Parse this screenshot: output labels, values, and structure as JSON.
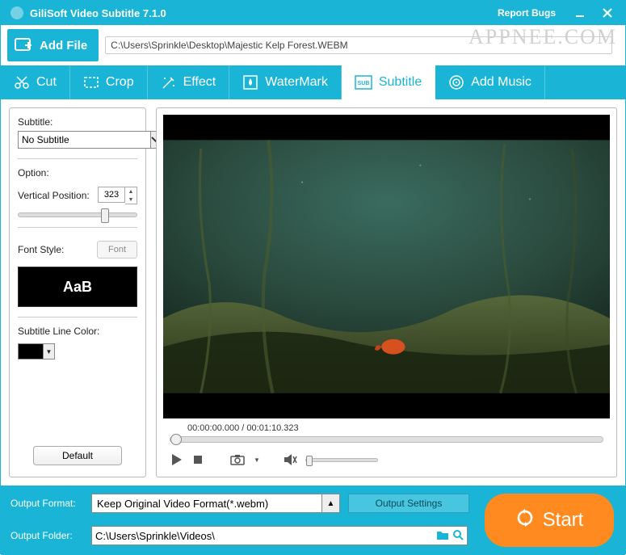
{
  "titlebar": {
    "title": "GiliSoft Video Subtitle 7.1.0",
    "report": "Report Bugs"
  },
  "toolbar": {
    "add_file": "Add File",
    "filepath": "C:\\Users\\Sprinkle\\Desktop\\Majestic Kelp Forest.WEBM",
    "watermark": "APPNEE.COM"
  },
  "tabs": {
    "cut": "Cut",
    "crop": "Crop",
    "effect": "Effect",
    "watermark": "WaterMark",
    "subtitle": "Subtitle",
    "add_music": "Add Music"
  },
  "sidebar": {
    "subtitle_label": "Subtitle:",
    "subtitle_value": "No Subtitle",
    "option_label": "Option:",
    "vpos_label": "Vertical Position:",
    "vpos_value": "323",
    "font_style_label": "Font Style:",
    "font_button": "Font",
    "font_preview": "AaB",
    "line_color_label": "Subtitle Line Color:",
    "line_color_value": "#000000",
    "default_button": "Default"
  },
  "player": {
    "time_current": "00:00:00.000",
    "time_total": "00:01:10.323"
  },
  "bottom": {
    "format_label": "Output Format:",
    "format_value": "Keep Original Video Format(*.webm)",
    "output_settings": "Output Settings",
    "folder_label": "Output Folder:",
    "folder_value": "C:\\Users\\Sprinkle\\Videos\\",
    "start": "Start"
  }
}
